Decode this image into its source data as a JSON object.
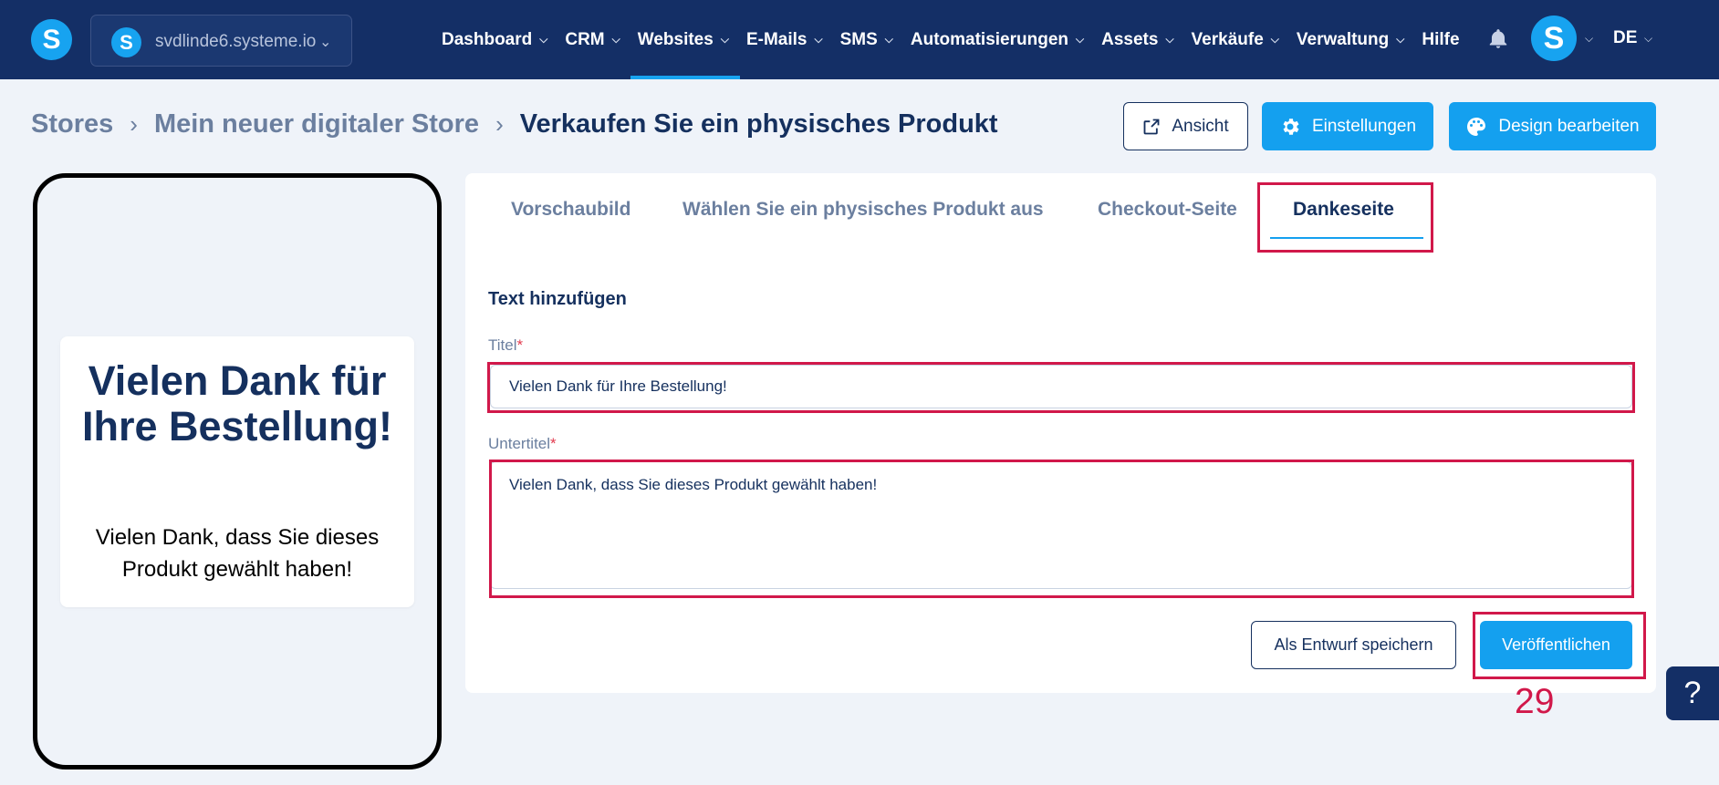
{
  "topbar": {
    "site_name": "svdlinde6.systeme.io",
    "nav": [
      {
        "label": "Dashboard",
        "active": false
      },
      {
        "label": "CRM",
        "active": false
      },
      {
        "label": "Websites",
        "active": true
      },
      {
        "label": "E-Mails",
        "active": false
      },
      {
        "label": "SMS",
        "active": false
      },
      {
        "label": "Automatisierungen",
        "active": false
      },
      {
        "label": "Assets",
        "active": false
      },
      {
        "label": "Verkäufe",
        "active": false
      },
      {
        "label": "Verwaltung",
        "active": false
      },
      {
        "label": "Hilfe",
        "active": false
      }
    ],
    "language": "DE"
  },
  "breadcrumb": [
    "Stores",
    "Mein neuer digitaler Store",
    "Verkaufen Sie ein physisches Produkt"
  ],
  "header_buttons": {
    "view": "Ansicht",
    "settings": "Einstellungen",
    "edit_design": "Design bearbeiten"
  },
  "preview": {
    "title": "Vielen Dank für Ihre Bestellung!",
    "subtitle": "Vielen Dank, dass Sie dieses Produkt gewählt haben!"
  },
  "tabs": [
    {
      "label": "Vorschaubild",
      "active": false
    },
    {
      "label": "Wählen Sie ein physisches Produkt aus",
      "active": false
    },
    {
      "label": "Checkout-Seite",
      "active": false
    },
    {
      "label": "Dankeseite",
      "active": true
    }
  ],
  "form": {
    "section_title": "Text hinzufügen",
    "title_label": "Titel",
    "title_value": "Vielen Dank für Ihre Bestellung!",
    "subtitle_label": "Untertitel",
    "subtitle_value": "Vielen Dank, dass Sie dieses Produkt gewählt haben!",
    "required_mark": "*"
  },
  "actions": {
    "save_draft": "Als Entwurf speichern",
    "publish": "Veröffentlichen"
  },
  "annotation": {
    "step_number": "29",
    "color": "#d1184a"
  },
  "help_label": "?",
  "colors": {
    "navbar": "#142f66",
    "primary": "#14a0ef",
    "text_dark": "#15305e"
  },
  "icons": {
    "logo": "systeme-logo-icon",
    "notifications": "bell-icon",
    "view": "external-link-icon",
    "settings": "gear-icon",
    "design": "palette-icon"
  }
}
